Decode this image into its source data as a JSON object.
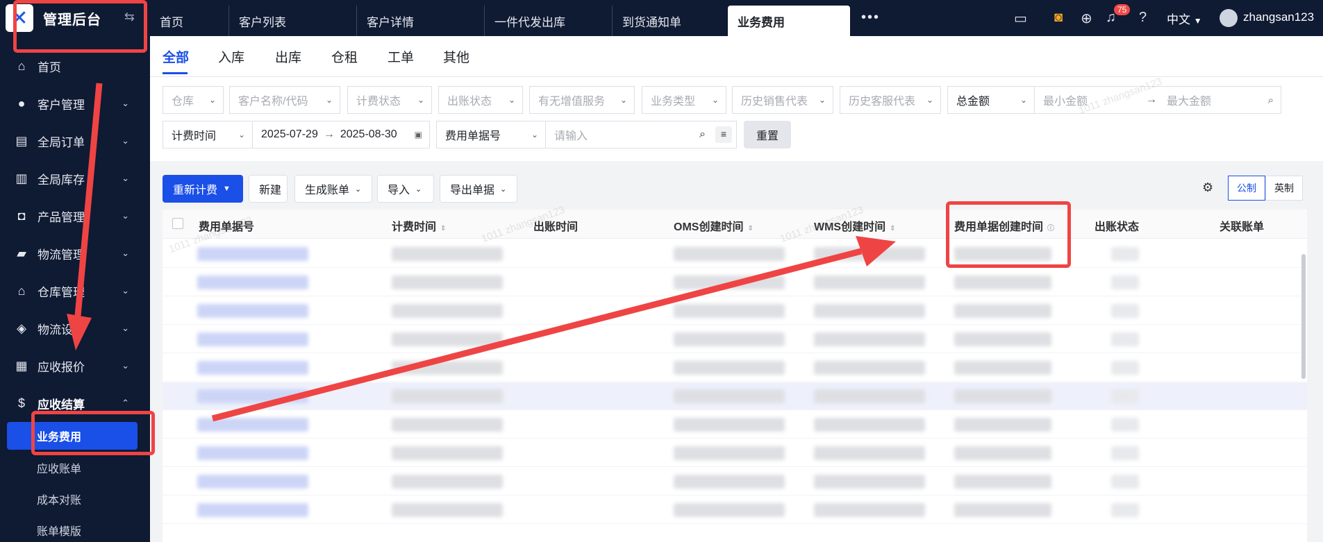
{
  "sidebar": {
    "brand_title": "管理后台",
    "items": [
      {
        "label": "首页",
        "icon": "home-icon"
      },
      {
        "label": "客户管理",
        "icon": "users-icon"
      },
      {
        "label": "全局订单",
        "icon": "clipboard-icon"
      },
      {
        "label": "全局库存",
        "icon": "warehouse-icon"
      },
      {
        "label": "产品管理",
        "icon": "bag-icon"
      },
      {
        "label": "物流管理",
        "icon": "truck-icon"
      },
      {
        "label": "仓库管理",
        "icon": "house-icon"
      },
      {
        "label": "物流设",
        "icon": "boxes-icon"
      },
      {
        "label": "应收报价",
        "icon": "document-icon"
      },
      {
        "label": "应收结算",
        "icon": "dollar-icon"
      }
    ],
    "sub_items": [
      "业务费用",
      "应收账单",
      "成本对账",
      "账单模版"
    ]
  },
  "topbar": {
    "tabs": [
      "首页",
      "客户列表",
      "客户详情",
      "一件代发出库",
      "到货通知单",
      "业务费用"
    ],
    "notification_count": "75",
    "language": "中文",
    "username": "zhangsan123"
  },
  "subtabs": [
    "全部",
    "入库",
    "出库",
    "仓租",
    "工单",
    "其他"
  ],
  "filters": {
    "row1": [
      "仓库",
      "客户名称/代码",
      "计费状态",
      "出账状态",
      "有无增值服务",
      "业务类型",
      "历史销售代表",
      "历史客服代表"
    ],
    "amount_type": "总金额",
    "min_amount": "最小金额",
    "max_amount": "最大金额",
    "time_type": "计费时间",
    "date_start": "2025-07-29",
    "date_end": "2025-08-30",
    "doc_type": "费用单据号",
    "search_placeholder": "请输入",
    "reset": "重置"
  },
  "toolbar": {
    "recalc": "重新计费",
    "create": "新建",
    "generate_bill": "生成账单",
    "import": "导入",
    "export": "导出单据",
    "metric": "公制",
    "imperial": "英制"
  },
  "table": {
    "columns": [
      "费用单据号",
      "计费时间",
      "出账时间",
      "OMS创建时间",
      "WMS创建时间",
      "费用单据创建时间",
      "出账状态",
      "关联账单"
    ]
  },
  "watermark": [
    "1011",
    "zhangsan123"
  ],
  "colors": {
    "accent": "#1a4fe8",
    "sidebar": "#0f1a33",
    "annotation": "#ef4444"
  }
}
